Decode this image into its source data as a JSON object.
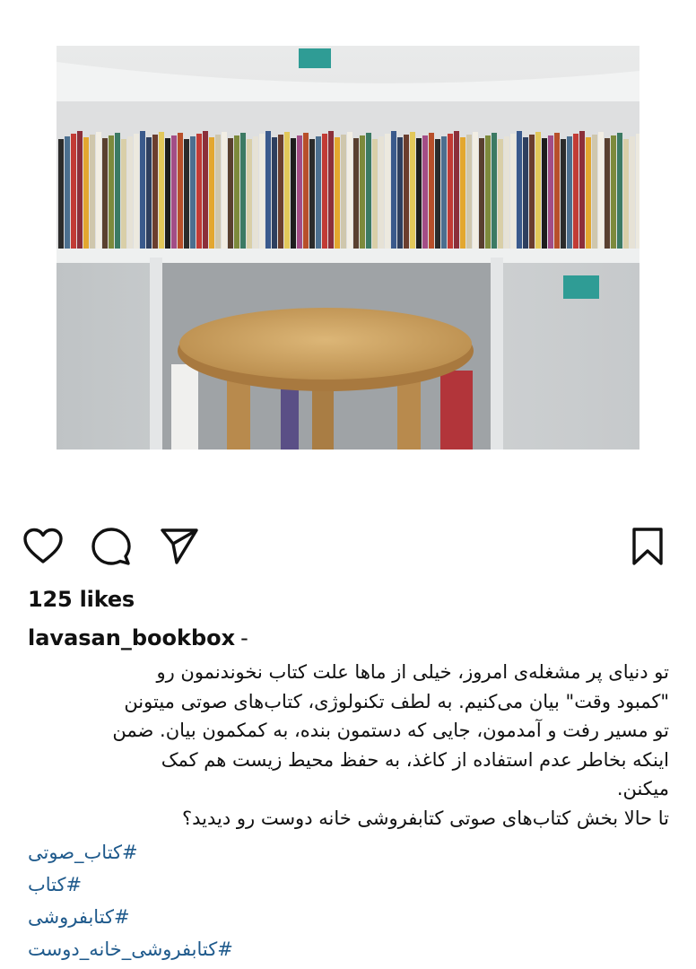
{
  "post": {
    "image_alt": "bookshelf with wooden stool",
    "likes_text": "125 likes",
    "username": "lavasan_bookbox",
    "username_suffix": "-",
    "caption_lines": [
      "تو دنیای پر مشغله‌ی امروز، خیلی از ماها علت کتاب نخوندنمون رو",
      "\"کمبود وقت\" بیان می‌کنیم. به لطف تکنولوژی، کتاب‌های صوتی میتونن",
      "تو مسیر رفت و آمدمون، جایی که دستمون بنده، به کمکمون بیان. ضمن",
      "اینکه بخاطر عدم استفاده از کاغذ، به حفظ محیط زیست هم کمک",
      "میکنن.",
      "تا حالا بخش کتاب‌های صوتی کتابفروشی خانه دوست رو دیدید؟"
    ],
    "hashtags": [
      "#کتاب_صوتی",
      "#کتاب",
      "#کتابفروشی",
      "#کتابفروشی_خانه_دوست"
    ]
  },
  "icons": {
    "like": "heart-icon",
    "comment": "comment-bubble-icon",
    "share": "paper-plane-icon",
    "save": "bookmark-icon"
  },
  "colors": {
    "hashtag": "#1f5a8c",
    "text": "#111111"
  }
}
